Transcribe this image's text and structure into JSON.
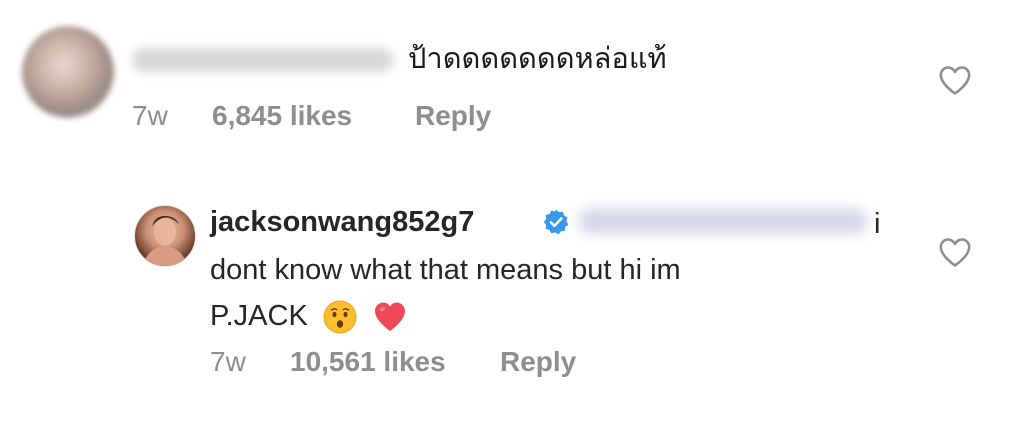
{
  "comments": [
    {
      "username": "",
      "username_blurred": true,
      "text": "ป้าดดดดดดดหล่อแท้",
      "time": "7w",
      "likes": "6,845 likes",
      "reply_label": "Reply",
      "like_icon": "heart-outline-icon"
    },
    {
      "username": "jacksonwang852g7",
      "verified": true,
      "verified_icon": "verified-badge-icon",
      "mention_blurred": true,
      "text_line_1": "i",
      "text_line_2": "dont know what that means but hi im",
      "text_line_3": "P.JACK",
      "emojis": [
        "hushed-face-emoji",
        "red-heart-emoji"
      ],
      "time": "7w",
      "likes": "10,561 likes",
      "reply_label": "Reply",
      "like_icon": "heart-outline-icon"
    }
  ],
  "colors": {
    "text": "#262626",
    "meta": "#8e8e8e",
    "verified": "#3897f0",
    "heart": "#ed4956",
    "emoji_face": "#fdbd2c"
  }
}
